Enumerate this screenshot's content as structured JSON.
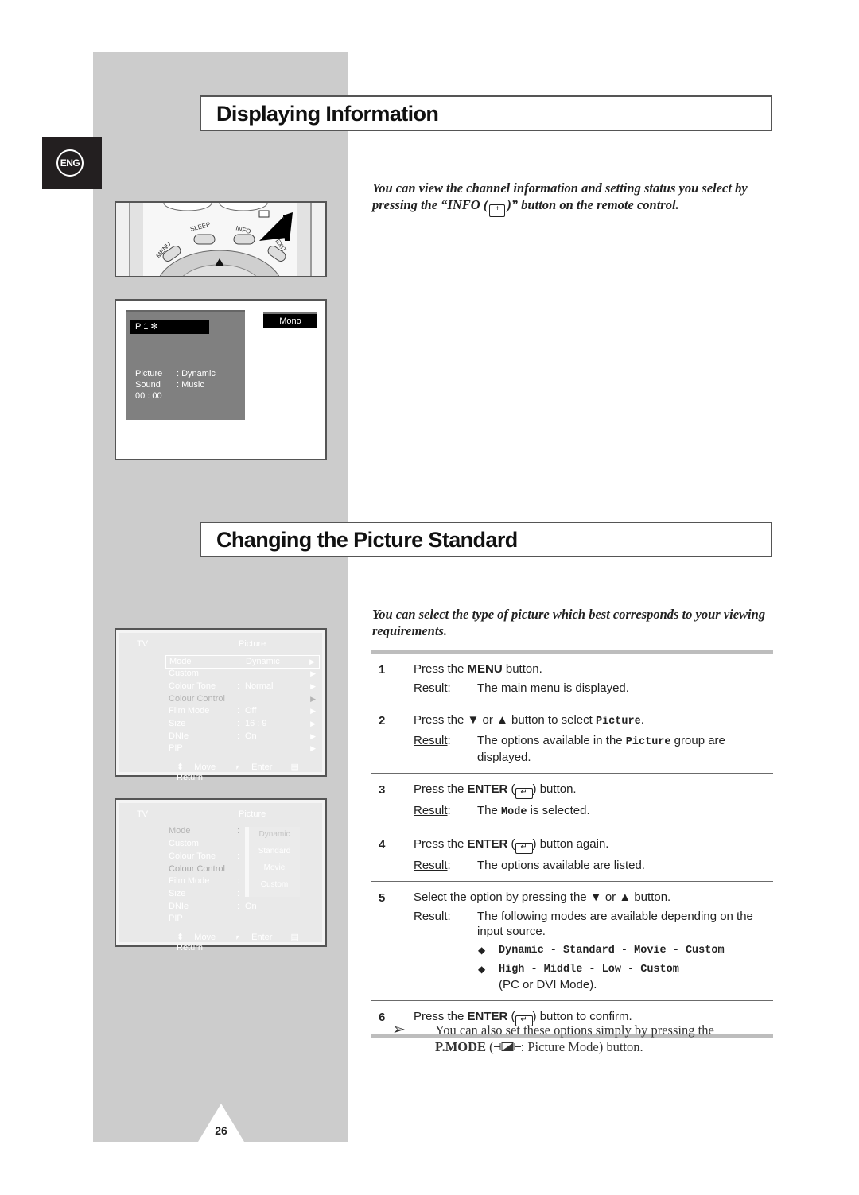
{
  "language_tab": "ENG",
  "sections": {
    "info": {
      "title": "Displaying Information",
      "intro_before_icon": "You can view the channel information and setting status you select by pressing the “INFO (",
      "intro_after_icon": ")” button on the remote control."
    },
    "picture": {
      "title": "Changing the Picture Standard",
      "intro": "You can select the type of picture which best corresponds to your viewing requirements."
    }
  },
  "remote": {
    "labels": [
      "MENU",
      "SLEEP",
      "INFO",
      "EXIT"
    ]
  },
  "info_screen": {
    "channel": "P 1  ✻",
    "audio": "Mono",
    "rows": [
      {
        "key": "Picture",
        "value": ": Dynamic"
      },
      {
        "key": "Sound",
        "value": ": Music"
      }
    ],
    "time": "00 : 00"
  },
  "picture_menu": {
    "source": "TV",
    "title": "Picture",
    "items": [
      {
        "label": "Mode",
        "value": "Dynamic",
        "has_value": true
      },
      {
        "label": "Custom",
        "value": "",
        "has_value": false
      },
      {
        "label": "Colour Tone",
        "value": "Normal",
        "has_value": true
      },
      {
        "label": "Colour Control",
        "value": "",
        "has_value": false
      },
      {
        "label": "Film Mode",
        "value": "Off",
        "has_value": true
      },
      {
        "label": "Size",
        "value": "16 : 9",
        "has_value": true
      },
      {
        "label": "DNIe",
        "value": "On",
        "has_value": true
      },
      {
        "label": "PIP",
        "value": "",
        "has_value": false
      }
    ],
    "footer": {
      "move": "Move",
      "enter": "Enter",
      "return": "Return"
    },
    "dropdown": [
      "Dynamic",
      "Standard",
      "Movie",
      "Custom"
    ]
  },
  "steps": [
    {
      "num": "1",
      "pre": "Press the ",
      "bold": "MENU",
      "post": " button.",
      "result_label": "Result",
      "result": "The main menu is displayed."
    },
    {
      "num": "2",
      "pre": "Press the ▼ or ▲ button to select ",
      "code": "Picture",
      "post": ".",
      "result_label": "Result",
      "result_pre": "The options available in the ",
      "result_code": "Picture",
      "result_post": " group are displayed."
    },
    {
      "num": "3",
      "pre": "Press the ",
      "bold": "ENTER",
      "post": " button.",
      "result_label": "Result",
      "result_pre": "The ",
      "result_code": "Mode",
      "result_post": " is selected."
    },
    {
      "num": "4",
      "pre": "Press the ",
      "bold": "ENTER",
      "post": " button again.",
      "result_label": "Result",
      "result": "The options available are listed."
    },
    {
      "num": "5",
      "pre": "Select the option by pressing the ▼ or ▲ button.",
      "result_label": "Result",
      "result": "The following modes are available depending on the input source.",
      "bullets": [
        "Dynamic - Standard - Movie - Custom",
        "High - Middle - Low - Custom"
      ],
      "bullet_note": "(PC or DVI Mode)."
    },
    {
      "num": "6",
      "pre": "Press the ",
      "bold": "ENTER",
      "post": " button to confirm."
    }
  ],
  "note": {
    "text": "You can also set these options simply by pressing the",
    "bold": "P.MODE",
    "after_icon": ": Picture Mode) button."
  },
  "page_number": "26"
}
